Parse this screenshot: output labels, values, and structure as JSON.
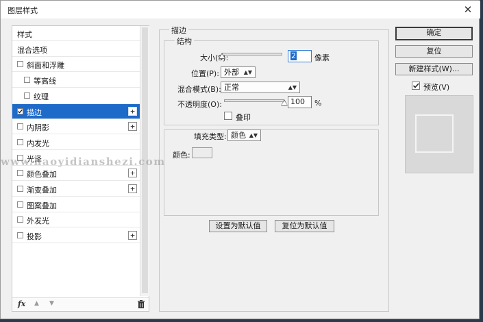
{
  "window": {
    "title": "图层样式",
    "close_label": "✕"
  },
  "styles_list": {
    "items": [
      {
        "label": "样式",
        "has_checkbox": false,
        "checked": false,
        "has_plus": false,
        "indent": 0,
        "selected": false
      },
      {
        "label": "混合选项",
        "has_checkbox": false,
        "checked": false,
        "has_plus": false,
        "indent": 0,
        "selected": false
      },
      {
        "label": "斜面和浮雕",
        "has_checkbox": true,
        "checked": false,
        "has_plus": false,
        "indent": 0,
        "selected": false
      },
      {
        "label": "等高线",
        "has_checkbox": true,
        "checked": false,
        "has_plus": false,
        "indent": 1,
        "selected": false
      },
      {
        "label": "纹理",
        "has_checkbox": true,
        "checked": false,
        "has_plus": false,
        "indent": 1,
        "selected": false
      },
      {
        "label": "描边",
        "has_checkbox": true,
        "checked": true,
        "has_plus": true,
        "indent": 0,
        "selected": true
      },
      {
        "label": "内阴影",
        "has_checkbox": true,
        "checked": false,
        "has_plus": true,
        "indent": 0,
        "selected": false
      },
      {
        "label": "内发光",
        "has_checkbox": true,
        "checked": false,
        "has_plus": false,
        "indent": 0,
        "selected": false
      },
      {
        "label": "光泽",
        "has_checkbox": true,
        "checked": false,
        "has_plus": false,
        "indent": 0,
        "selected": false
      },
      {
        "label": "颜色叠加",
        "has_checkbox": true,
        "checked": false,
        "has_plus": true,
        "indent": 0,
        "selected": false
      },
      {
        "label": "渐变叠加",
        "has_checkbox": true,
        "checked": false,
        "has_plus": true,
        "indent": 0,
        "selected": false
      },
      {
        "label": "图案叠加",
        "has_checkbox": true,
        "checked": false,
        "has_plus": false,
        "indent": 0,
        "selected": false
      },
      {
        "label": "外发光",
        "has_checkbox": true,
        "checked": false,
        "has_plus": false,
        "indent": 0,
        "selected": false
      },
      {
        "label": "投影",
        "has_checkbox": true,
        "checked": false,
        "has_plus": true,
        "indent": 0,
        "selected": false
      }
    ],
    "footer": {
      "fx_label": "fx",
      "up_icon": "arrow-up-icon",
      "down_icon": "arrow-down-icon",
      "delete_icon": "trash-icon"
    }
  },
  "stroke": {
    "section_title": "描边",
    "structure": {
      "title": "结构",
      "size_label": "大小(S):",
      "size_value": "2",
      "size_unit": "像素",
      "size_slider_fraction": 0.0,
      "position_label": "位置(P):",
      "position_value": "外部",
      "blend_label": "混合模式(B):",
      "blend_value": "正常",
      "opacity_label": "不透明度(O):",
      "opacity_value": "100",
      "opacity_unit": "%",
      "opacity_slider_fraction": 1.0,
      "overprint_label": "叠印",
      "overprint_checked": false
    },
    "fill": {
      "type_label": "填充类型:",
      "type_value": "颜色",
      "color_label": "颜色:",
      "color": "#ececec"
    },
    "set_default_label": "设置为默认值",
    "reset_default_label": "复位为默认值"
  },
  "side_buttons": {
    "ok_label": "确定",
    "reset_label": "复位",
    "new_style_label": "新建样式(W)...",
    "preview_label": "预览(V)",
    "preview_checked": true
  },
  "watermark": "www.haoyidianshezi.com"
}
